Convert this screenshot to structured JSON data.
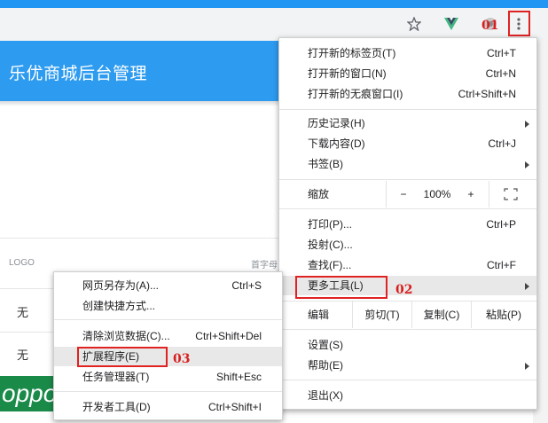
{
  "browser": {
    "icons": [
      "star-icon",
      "vue-devtools-icon",
      "extension-icon",
      "menu-kebab-icon"
    ]
  },
  "page": {
    "title": "乐优商城后台管理",
    "columns": {
      "logo": "LOGO",
      "initial": "首字母"
    },
    "rows": [
      {
        "logo": "无"
      },
      {
        "logo": "无"
      }
    ],
    "brand_logo_text": "oppo"
  },
  "chrome_menu": {
    "items_top": [
      {
        "label": "打开新的标签页(T)",
        "shortcut": "Ctrl+T"
      },
      {
        "label": "打开新的窗口(N)",
        "shortcut": "Ctrl+N"
      },
      {
        "label": "打开新的无痕窗口(I)",
        "shortcut": "Ctrl+Shift+N"
      }
    ],
    "items_history": [
      {
        "label": "历史记录(H)",
        "shortcut": ""
      },
      {
        "label": "下载内容(D)",
        "shortcut": "Ctrl+J"
      },
      {
        "label": "书签(B)",
        "shortcut": ""
      }
    ],
    "zoom": {
      "label": "缩放",
      "minus": "−",
      "value": "100%",
      "plus": "+"
    },
    "items_tools": [
      {
        "label": "打印(P)...",
        "shortcut": "Ctrl+P"
      },
      {
        "label": "投射(C)...",
        "shortcut": ""
      },
      {
        "label": "查找(F)...",
        "shortcut": "Ctrl+F"
      },
      {
        "label": "更多工具(L)",
        "shortcut": ""
      }
    ],
    "edit": {
      "label": "编辑",
      "cut": "剪切(T)",
      "copy": "复制(C)",
      "paste": "粘贴(P)"
    },
    "items_settings": [
      {
        "label": "设置(S)",
        "shortcut": ""
      },
      {
        "label": "帮助(E)",
        "shortcut": ""
      }
    ],
    "exit": {
      "label": "退出(X)"
    }
  },
  "more_tools_menu": {
    "items": [
      {
        "label": "网页另存为(A)...",
        "shortcut": "Ctrl+S"
      },
      {
        "label": "创建快捷方式...",
        "shortcut": ""
      },
      {
        "label": "清除浏览数据(C)...",
        "shortcut": "Ctrl+Shift+Del"
      },
      {
        "label": "扩展程序(E)",
        "shortcut": ""
      },
      {
        "label": "任务管理器(T)",
        "shortcut": "Shift+Esc"
      },
      {
        "label": "开发者工具(D)",
        "shortcut": "Ctrl+Shift+I"
      }
    ]
  },
  "annotations": {
    "step1": "01",
    "step2": "02",
    "step3": "03"
  },
  "colors": {
    "accent_red": "#e02222",
    "header_blue": "#2d9bf0"
  }
}
